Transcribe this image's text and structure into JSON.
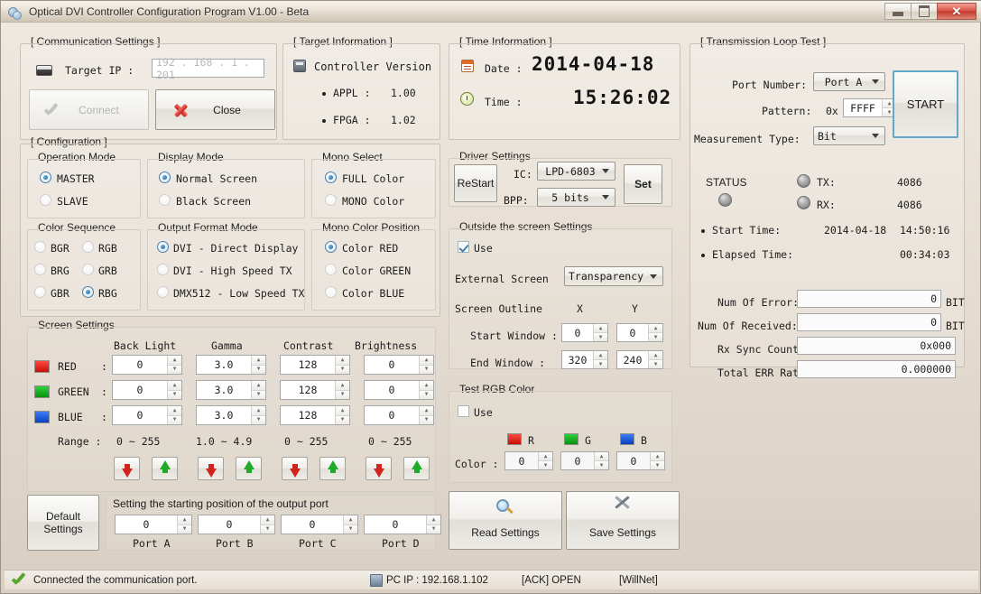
{
  "window": {
    "title": "Optical DVI Controller Configuration Program V1.00 - Beta",
    "minimize_label": "",
    "maximize_label": "",
    "close_label": "✕"
  },
  "communication": {
    "caption": "[ Communication Settings ]",
    "target_ip_label": "Target IP :",
    "target_ip_value": "192 . 168 .  1  . 201",
    "connect_label": "Connect",
    "close_label": "Close"
  },
  "target_information": {
    "caption": "[ Target Information ]",
    "controller_version_label": "Controller Version",
    "appl_label": "APPL :",
    "appl_value": "1.00",
    "fpga_label": "FPGA :",
    "fpga_value": "1.02"
  },
  "time_information": {
    "caption": "[ Time Information ]",
    "date_label": "Date :",
    "date_value": "2014-04-18",
    "time_label": "Time :",
    "time_value": "15:26:02"
  },
  "transmission": {
    "caption": "[ Transmission Loop Test ]",
    "port_number_label": "Port Number:",
    "port_number_value": "Port A",
    "pattern_label": "Pattern:",
    "pattern_prefix": "0x",
    "pattern_value": "FFFF",
    "measurement_label": "Measurement Type:",
    "measurement_value": "Bit",
    "start_button": "START",
    "status_label": "STATUS",
    "tx_label": "TX:",
    "tx_value": "4086",
    "rx_label": "RX:",
    "rx_value": "4086",
    "start_time_label": "Start  Time:",
    "start_time_date": "2014-04-18",
    "start_time_clock": "14:50:16",
    "elapsed_label": "Elapsed Time:",
    "elapsed_value": "00:34:03",
    "stats": [
      {
        "label": "Num Of Error:",
        "value": "0",
        "unit": "BIT"
      },
      {
        "label": "Num Of Received:",
        "value": "0",
        "unit": "BIT"
      },
      {
        "label": "Rx Sync Count:",
        "value": "0x000",
        "unit": ""
      },
      {
        "label": "Total ERR Rate:",
        "value": "0.000000",
        "unit": ""
      }
    ]
  },
  "configuration": {
    "caption": "[ Configuration ]",
    "operation_mode": {
      "caption": "Operation Mode",
      "options": [
        "MASTER",
        "SLAVE"
      ],
      "selected": "MASTER"
    },
    "display_mode": {
      "caption": "Display Mode",
      "options": [
        "Normal Screen",
        "Black  Screen"
      ],
      "selected": "Normal Screen"
    },
    "mono_select": {
      "caption": "Mono Select",
      "options": [
        "FULL Color",
        "MONO Color"
      ],
      "selected": "FULL Color"
    },
    "color_sequence": {
      "caption": "Color Sequence",
      "options": [
        "BGR",
        "RGB",
        "BRG",
        "GRB",
        "GBR",
        "RBG"
      ],
      "selected": "RBG"
    },
    "output_format": {
      "caption": "Output Format Mode",
      "options": [
        "DVI - Direct Display",
        "DVI - High Speed TX",
        "DMX512 - Low Speed TX"
      ],
      "selected": "DVI - Direct Display"
    },
    "mono_color_position": {
      "caption": "Mono Color Position",
      "options": [
        "Color RED",
        "Color GREEN",
        "Color BLUE"
      ],
      "selected": "Color RED"
    }
  },
  "driver_settings": {
    "caption": "Driver Settings",
    "restart_label": "ReStart",
    "ic_label": "IC:",
    "ic_value": "LPD-6803",
    "bpp_label": "BPP:",
    "bpp_value": "5 bits",
    "set_label": "Set"
  },
  "outside_screen": {
    "caption": "Outside the screen Settings",
    "use_label": "Use",
    "use_checked": true,
    "external_screen_label": "External Screen",
    "external_screen_value": "Transparency",
    "screen_outline_label": "Screen Outline",
    "x_header": "X",
    "y_header": "Y",
    "start_window_label": "Start Window :",
    "start_x": "0",
    "start_y": "0",
    "end_window_label": "End  Window :",
    "end_x": "320",
    "end_y": "240"
  },
  "test_rgb": {
    "caption": "Test RGB Color",
    "use_label": "Use",
    "use_checked": false,
    "r_label": "R",
    "g_label": "G",
    "b_label": "B",
    "color_label": "Color :",
    "r_value": "0",
    "g_value": "0",
    "b_value": "0"
  },
  "screen_settings": {
    "caption": "Screen Settings",
    "columns": [
      "Back Light",
      "Gamma",
      "Contrast",
      "Brightness"
    ],
    "rows": [
      {
        "name": "RED",
        "color": "#e01c14",
        "values": [
          "0",
          "3.0",
          "128",
          "0"
        ]
      },
      {
        "name": "GREEN",
        "color": "#12a31a",
        "values": [
          "0",
          "3.0",
          "128",
          "0"
        ]
      },
      {
        "name": "BLUE",
        "color": "#1450d8",
        "values": [
          "0",
          "3.0",
          "128",
          "0"
        ]
      }
    ],
    "range_label": "Range :",
    "ranges": [
      "0 ~ 255",
      "1.0 ~ 4.9",
      "0 ~ 255",
      "0 ~ 255"
    ]
  },
  "output_port": {
    "default_settings_line1": "Default",
    "default_settings_line2": "Settings",
    "caption": "Setting the starting position of the output port",
    "ports": [
      {
        "label": "Port A",
        "value": "0"
      },
      {
        "label": "Port B",
        "value": "0"
      },
      {
        "label": "Port C",
        "value": "0"
      },
      {
        "label": "Port D",
        "value": "0"
      }
    ]
  },
  "actions": {
    "read_label": "Read Settings",
    "save_label": "Save Settings"
  },
  "statusbar": {
    "message": "Connected the communication port.",
    "pc_ip": "PC  IP : 192.168.1.102",
    "ack": "[ACK] OPEN",
    "vendor": "[WillNet]"
  }
}
